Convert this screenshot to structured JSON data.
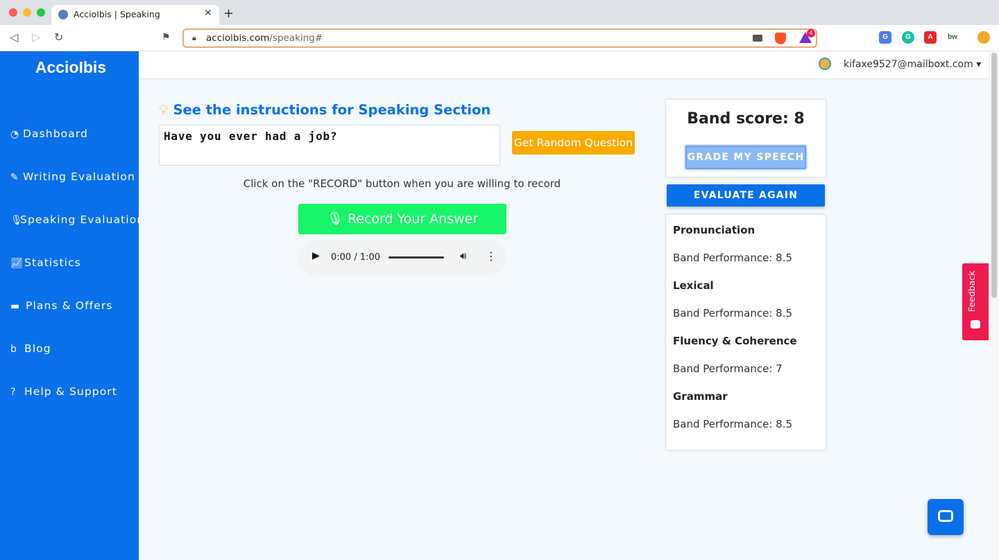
{
  "browser": {
    "tab_title": "AccioIbis | Speaking",
    "url_domain": "accioibis.com",
    "url_path": "/speaking#",
    "extension_badge": "4",
    "icons": [
      "back-icon",
      "forward-icon",
      "reload-icon",
      "bookmark-icon",
      "lock-icon",
      "camera-icon",
      "brave-icon",
      "rewards-icon",
      "translate-icon",
      "grammarly-icon",
      "pdf-icon",
      "bw-icon",
      "update-icon"
    ]
  },
  "sidebar": {
    "brand": "AccioIbis",
    "items": [
      {
        "label": "Dashboard",
        "icon": "dashboard-icon"
      },
      {
        "label": "Writing Evaluation",
        "icon": "pencil-icon"
      },
      {
        "label": "Speaking Evaluation",
        "icon": "microphone-icon"
      },
      {
        "label": "Statistics",
        "icon": "chart-icon"
      },
      {
        "label": "Plans & Offers",
        "icon": "credit-card-icon"
      },
      {
        "label": "Blog",
        "icon": "blog-icon"
      },
      {
        "label": "Help & Support",
        "icon": "question-icon"
      }
    ]
  },
  "header": {
    "user_email": "kifaxe9527@mailboxt.com",
    "dropdown_caret": "▾"
  },
  "main": {
    "instructions_link": "See the instructions for Speaking Section",
    "question": "Have you ever had a job?",
    "random_button": "Get Random Question",
    "hint": "Click on the \"RECORD\" button when you are willing to record",
    "record_button": "Record Your Answer",
    "audio": {
      "time": "0:00 / 1:00"
    }
  },
  "results": {
    "band_score": "Band score: 8",
    "grade_button": "GRADE MY SPEECH",
    "evaluate_button": "EVALUATE AGAIN",
    "criteria": [
      {
        "name": "Pronunciation",
        "performance": "Band Performance: 8.5"
      },
      {
        "name": "Lexical",
        "performance": "Band Performance: 8.5"
      },
      {
        "name": "Fluency & Coherence",
        "performance": "Band Performance: 7"
      },
      {
        "name": "Grammar",
        "performance": "Band Performance: 8.5"
      }
    ]
  },
  "feedback_tab": "Feedback",
  "colors": {
    "primary": "#0a70ea",
    "record": "#18f56a",
    "random": "#f9ab00",
    "feedback": "#ee1b4f"
  }
}
